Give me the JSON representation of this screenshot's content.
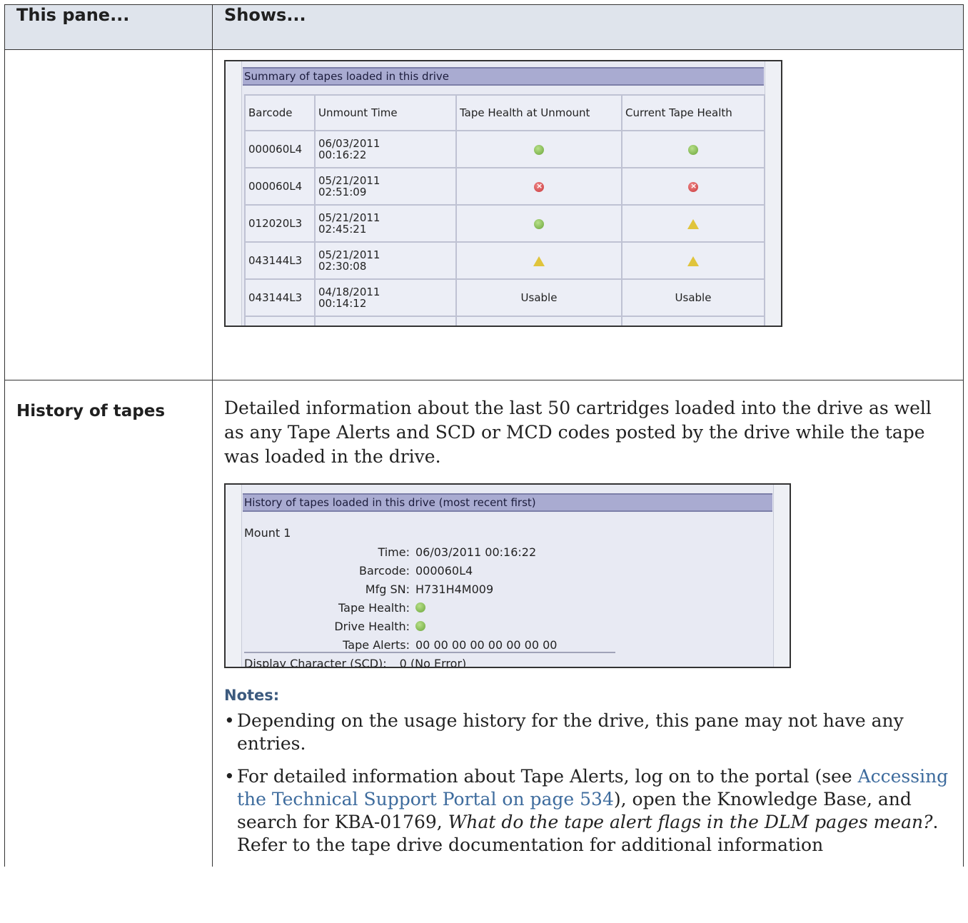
{
  "table": {
    "headers": [
      "This pane...",
      "Shows..."
    ],
    "row1": {
      "pane": ""
    },
    "row2": {
      "pane": "History of tapes",
      "description": "Detailed information about the last 50 cartridges loaded into the drive as well as any Tape Alerts and SCD or MCD codes posted by the drive while the tape was loaded in the drive."
    }
  },
  "summary_shot": {
    "title": "Summary of tapes loaded in this drive",
    "columns": [
      "Barcode",
      "Unmount Time",
      "Tape Health at Unmount",
      "Current Tape Health"
    ],
    "rows": [
      {
        "barcode": "000060L4",
        "date": "06/03/2011",
        "time": "00:16:22",
        "health_unmount": "ok-icon",
        "health_current": "ok-icon"
      },
      {
        "barcode": "000060L4",
        "date": "05/21/2011",
        "time": "02:51:09",
        "health_unmount": "error-icon",
        "health_current": "error-icon"
      },
      {
        "barcode": "012020L3",
        "date": "05/21/2011",
        "time": "02:45:21",
        "health_unmount": "ok-icon",
        "health_current": "warning-icon"
      },
      {
        "barcode": "043144L3",
        "date": "05/21/2011",
        "time": "02:30:08",
        "health_unmount": "warning-icon",
        "health_current": "warning-icon"
      },
      {
        "barcode": "043144L3",
        "date": "04/18/2011",
        "time": "00:14:12",
        "health_unmount_text": "Usable",
        "health_current_text": "Usable"
      }
    ]
  },
  "history_shot": {
    "title": "History of tapes loaded in this drive (most recent first)",
    "mount": "Mount 1",
    "fields": [
      {
        "label": "Time:",
        "value": "06/03/2011 00:16:22"
      },
      {
        "label": "Barcode:",
        "value": "000060L4"
      },
      {
        "label": "Mfg SN:",
        "value": "H731H4M009"
      },
      {
        "label": "Tape Health:",
        "icon": "ok-icon"
      },
      {
        "label": "Drive Health:",
        "icon": "ok-icon"
      },
      {
        "label": "Tape Alerts:",
        "value": "00 00 00 00 00 00 00 00"
      },
      {
        "label": "Display Character (SCD):",
        "value": "0 (No Error)"
      }
    ]
  },
  "notes": {
    "heading": "Notes:",
    "note1": "Depending on the usage history for the drive, this pane may not have any entries.",
    "note2_a": "For detailed information about Tape Alerts, log on to the portal (see ",
    "note2_link": "Accessing the Technical Support Portal on page 534",
    "note2_b": "), open the Knowledge Base, and search for KBA-01769, ",
    "note2_em": "What do the tape alert flags in the DLM pages mean?",
    "note2_c": ". Refer to the tape drive documentation for additional information"
  }
}
